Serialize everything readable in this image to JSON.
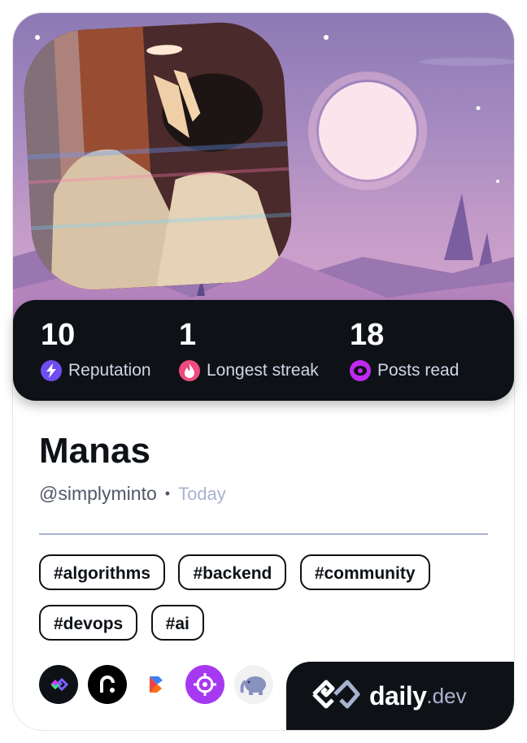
{
  "profile": {
    "name": "Manas",
    "handle": "@simplyminto",
    "date": "Today",
    "date_separator": "•"
  },
  "stats": [
    {
      "value": "10",
      "label": "Reputation",
      "icon": "bolt-icon",
      "color": "#6f4df0"
    },
    {
      "value": "1",
      "label": "Longest streak",
      "icon": "flame-icon",
      "color": "#ef4b7e"
    },
    {
      "value": "18",
      "label": "Posts read",
      "icon": "eye-icon",
      "color": "#c029f0"
    }
  ],
  "tags": [
    "#algorithms",
    "#backend",
    "#community",
    "#devops",
    "#ai"
  ],
  "sources": [
    {
      "icon": "daily-dev-source-icon",
      "color": "#0e1217"
    },
    {
      "icon": "r-source-icon",
      "color": "#000000"
    },
    {
      "icon": "b-source-icon",
      "color": "#ffffff"
    },
    {
      "icon": "target-source-icon",
      "color": "#a738f2"
    },
    {
      "icon": "php-elephant-source-icon",
      "color": "#f1f1f1"
    }
  ],
  "brand": {
    "name": "daily",
    "suffix": ".dev"
  }
}
